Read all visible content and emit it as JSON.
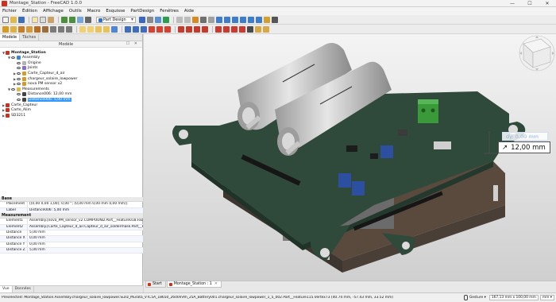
{
  "window": {
    "title": "Montage_Station - FreeCAD 1.0.0",
    "minimize": "—",
    "maximize": "☐",
    "close": "✕"
  },
  "menu": [
    "Fichier",
    "Édition",
    "Affichage",
    "Outils",
    "Macro",
    "Esquisse",
    "PartDesign",
    "Fenêtres",
    "Aide"
  ],
  "workbench": "Part Design",
  "combo_view": {
    "tabs": [
      "Modèle",
      "Tâches"
    ],
    "header_label": "Modèle",
    "header_controls": "☐ ✕",
    "tree": [
      {
        "label": "Montage_Station",
        "level": 0,
        "expanded": "▼",
        "icon": "document-icon"
      },
      {
        "label": "Assembly",
        "level": 1,
        "expanded": "▼",
        "icon": "assembly-icon"
      },
      {
        "label": "Origine",
        "level": 2,
        "expanded": "",
        "icon": "origin-icon"
      },
      {
        "label": "Joints",
        "level": 2,
        "expanded": "",
        "icon": "joints-icon"
      },
      {
        "label": "Carte_Capteur_d_air",
        "level": 2,
        "expanded": "▶",
        "icon": "part-icon"
      },
      {
        "label": "chargeur_solaire_lowpower",
        "level": 2,
        "expanded": "▶",
        "icon": "part-icon"
      },
      {
        "label": "nova PM sensor v2",
        "level": 2,
        "expanded": "▶",
        "icon": "part-icon"
      },
      {
        "label": "Measurements",
        "level": 1,
        "expanded": "▼",
        "icon": "folder-icon"
      },
      {
        "label": "Distance006: 12,00 mm",
        "level": 2,
        "expanded": "",
        "icon": "measure-icon"
      },
      {
        "label": "Distance006: 5,00 mm",
        "level": 2,
        "expanded": "",
        "icon": "measure-icon",
        "selected": true
      },
      {
        "label": "Carte_Capteur",
        "level": 0,
        "expanded": "▶",
        "icon": "document-icon"
      },
      {
        "label": "Carte_Alim",
        "level": 0,
        "expanded": "▶",
        "icon": "document-icon"
      },
      {
        "label": "SD3211",
        "level": 0,
        "expanded": "▶",
        "icon": "document-icon"
      }
    ]
  },
  "property_view": {
    "groups": [
      {
        "name": "Base",
        "rows": [
          {
            "key": "Placement",
            "value": "[(0,00 0,00 1,00); 0,00 °; (0,00 mm  0,00 mm  0,00 mm)]"
          },
          {
            "key": "Label",
            "value": "Distance006: 5,00 mm"
          }
        ]
      },
      {
        "name": "Measurement",
        "rows": [
          {
            "key": "Element1",
            "value": "Assembly.[nova_PM_sensor_v2.COMPOUND.Part__Feature018.Face218"
          },
          {
            "key": "Element2",
            "value": "Assembly.[Carte_Capteur_d_air.Capteur_d_air_soldermask.Part__Featu"
          },
          {
            "key": "Distance",
            "value": "5,00 mm"
          },
          {
            "key": "Distance X",
            "value": "0,00 mm"
          },
          {
            "key": "Distance Y",
            "value": "0,00 mm"
          },
          {
            "key": "Distance Z",
            "value": "5,00 mm"
          }
        ]
      }
    ],
    "bottom_tabs": [
      "Vue",
      "Données"
    ]
  },
  "viewport": {
    "measure_primary": "12,00 mm",
    "measure_secondary": "0,00 mm",
    "measure_icon": "↗",
    "secondary_prefix": "dy:",
    "colors": {
      "board": "#2f4a3a",
      "battery": "#bcbcbc",
      "connector": "#3a9a3a",
      "potentiometer": "#2c4fa0"
    }
  },
  "doc_tabs": [
    {
      "label": "Start",
      "active": false
    },
    {
      "label": "Montage_Station : 1",
      "active": true
    }
  ],
  "status": {
    "message": "Preselected: Montage_Station.Assembly.chargeur_solaire_lowpower.Sunz_Murata_VTC5A_18650_2600mAh_25A_Battery001.chargeur_solaire_lowpower_1_5_002.Part__Feature115.Vertex73 (40.74 mm, -57.43 mm, 33.52 mm)",
    "nav_style": "Gesture",
    "dimensions": "167,13 mm x 100,00 mm",
    "units": "mm"
  }
}
